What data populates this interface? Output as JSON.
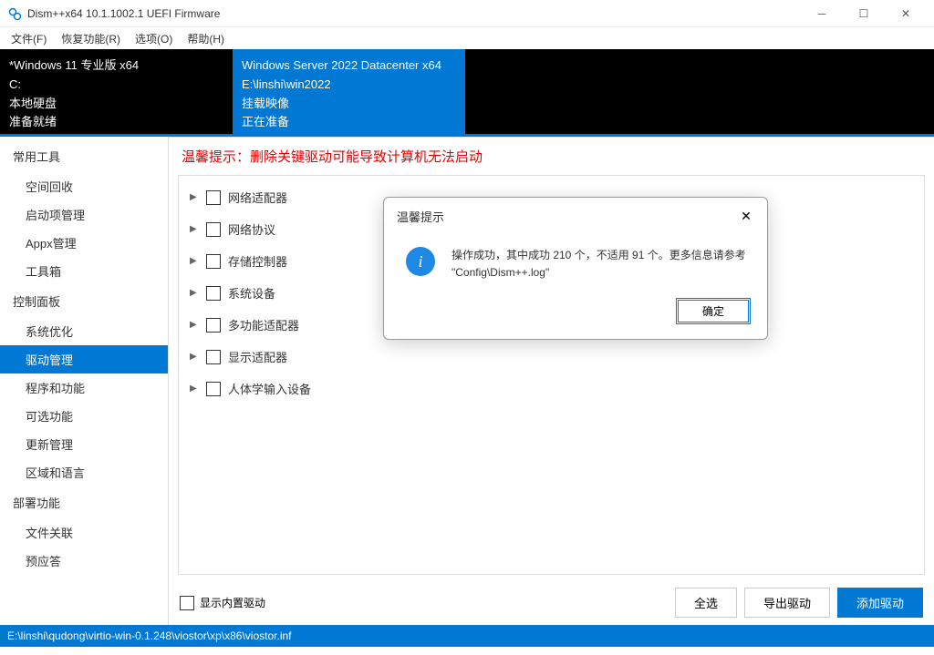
{
  "titlebar": {
    "text": "Dism++x64 10.1.1002.1 UEFI Firmware"
  },
  "menubar": {
    "items": [
      "文件(F)",
      "恢复功能(R)",
      "选项(O)",
      "帮助(H)"
    ]
  },
  "os_cards": [
    {
      "line1": "*Windows 11 专业版 x64",
      "line2": "C:",
      "line3": "本地硬盘",
      "line4": "准备就绪"
    },
    {
      "line1": "Windows Server 2022 Datacenter x64",
      "line2": "E:\\linshi\\win2022",
      "line3": "挂载映像",
      "line4": "正在准备"
    }
  ],
  "sidebar": {
    "sections": [
      {
        "header": "常用工具",
        "items": [
          "空间回收",
          "启动项管理",
          "Appx管理",
          "工具箱"
        ]
      },
      {
        "header": "控制面板",
        "items": [
          "系统优化",
          "驱动管理",
          "程序和功能",
          "可选功能",
          "更新管理",
          "区域和语言"
        ]
      },
      {
        "header": "部署功能",
        "items": [
          "文件关联",
          "预应答"
        ]
      }
    ],
    "active": "驱动管理"
  },
  "main": {
    "warning": "温馨提示：删除关键驱动可能导致计算机无法启动",
    "tree_items": [
      "网络适配器",
      "网络协议",
      "存储控制器",
      "系统设备",
      "多功能适配器",
      "显示适配器",
      "人体学输入设备"
    ],
    "show_builtin_label": "显示内置驱动",
    "buttons": {
      "select_all": "全选",
      "export": "导出驱动",
      "add": "添加驱动"
    }
  },
  "dialog": {
    "title": "温馨提示",
    "message": "操作成功，其中成功 210 个，不适用 91 个。更多信息请参考 \"Config\\Dism++.log\"",
    "ok": "确定"
  },
  "statusbar": {
    "text": "E:\\linshi\\qudong\\virtio-win-0.1.248\\viostor\\xp\\x86\\viostor.inf"
  }
}
